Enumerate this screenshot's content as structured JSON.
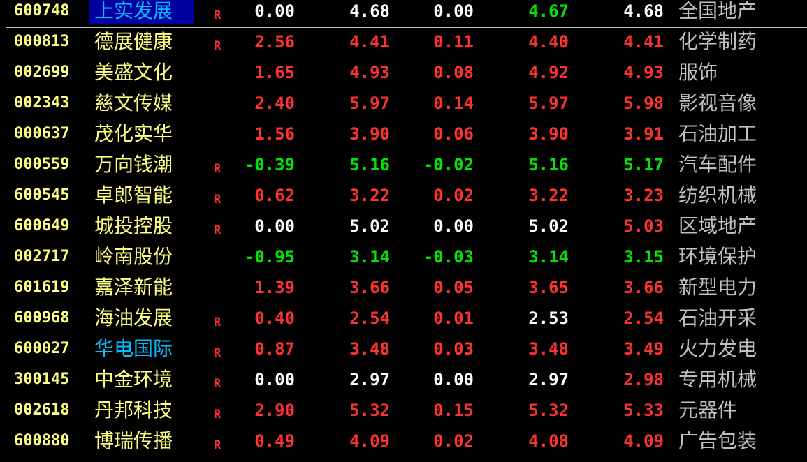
{
  "colors": {
    "background": "#000000",
    "up": "#ff3232",
    "down": "#00e600",
    "flat": "#ffffff",
    "code": "#ffff80",
    "highlight_name": "#00c0ff",
    "selection_bg": "#0000a0",
    "industry": "#c0c0c0",
    "flag": "#ff3030"
  },
  "rows": [
    {
      "code": "600748",
      "name": "上实发展",
      "flag": "R",
      "change": "0.00",
      "price": "4.68",
      "change_amount": "0.00",
      "bid": "4.67",
      "ask": "4.68",
      "industry": "全国地产",
      "state": "flat",
      "bid_state": "down",
      "ask_state": "flat",
      "name_style": "selected"
    },
    {
      "code": "000813",
      "name": "德展健康",
      "flag": "R",
      "change": "2.56",
      "price": "4.41",
      "change_amount": "0.11",
      "bid": "4.40",
      "ask": "4.41",
      "industry": "化学制药",
      "state": "up",
      "bid_state": "up",
      "ask_state": "up",
      "name_style": "normal"
    },
    {
      "code": "002699",
      "name": "美盛文化",
      "flag": "",
      "change": "1.65",
      "price": "4.93",
      "change_amount": "0.08",
      "bid": "4.92",
      "ask": "4.93",
      "industry": "服饰",
      "state": "up",
      "bid_state": "up",
      "ask_state": "up",
      "name_style": "normal"
    },
    {
      "code": "002343",
      "name": "慈文传媒",
      "flag": "",
      "change": "2.40",
      "price": "5.97",
      "change_amount": "0.14",
      "bid": "5.97",
      "ask": "5.98",
      "industry": "影视音像",
      "state": "up",
      "bid_state": "up",
      "ask_state": "up",
      "name_style": "normal"
    },
    {
      "code": "000637",
      "name": "茂化实华",
      "flag": "",
      "change": "1.56",
      "price": "3.90",
      "change_amount": "0.06",
      "bid": "3.90",
      "ask": "3.91",
      "industry": "石油加工",
      "state": "up",
      "bid_state": "up",
      "ask_state": "up",
      "name_style": "normal"
    },
    {
      "code": "000559",
      "name": "万向钱潮",
      "flag": "R",
      "change": "-0.39",
      "price": "5.16",
      "change_amount": "-0.02",
      "bid": "5.16",
      "ask": "5.17",
      "industry": "汽车配件",
      "state": "down",
      "bid_state": "down",
      "ask_state": "down",
      "name_style": "normal"
    },
    {
      "code": "600545",
      "name": "卓郎智能",
      "flag": "R",
      "change": "0.62",
      "price": "3.22",
      "change_amount": "0.02",
      "bid": "3.22",
      "ask": "3.23",
      "industry": "纺织机械",
      "state": "up",
      "bid_state": "up",
      "ask_state": "up",
      "name_style": "normal"
    },
    {
      "code": "600649",
      "name": "城投控股",
      "flag": "R",
      "change": "0.00",
      "price": "5.02",
      "change_amount": "0.00",
      "bid": "5.02",
      "ask": "5.03",
      "industry": "区域地产",
      "state": "flat",
      "bid_state": "flat",
      "ask_state": "up",
      "name_style": "normal"
    },
    {
      "code": "002717",
      "name": "岭南股份",
      "flag": "",
      "change": "-0.95",
      "price": "3.14",
      "change_amount": "-0.03",
      "bid": "3.14",
      "ask": "3.15",
      "industry": "环境保护",
      "state": "down",
      "bid_state": "down",
      "ask_state": "down",
      "name_style": "normal"
    },
    {
      "code": "601619",
      "name": "嘉泽新能",
      "flag": "",
      "change": "1.39",
      "price": "3.66",
      "change_amount": "0.05",
      "bid": "3.65",
      "ask": "3.66",
      "industry": "新型电力",
      "state": "up",
      "bid_state": "up",
      "ask_state": "up",
      "name_style": "normal"
    },
    {
      "code": "600968",
      "name": "海油发展",
      "flag": "R",
      "change": "0.40",
      "price": "2.54",
      "change_amount": "0.01",
      "bid": "2.53",
      "ask": "2.54",
      "industry": "石油开采",
      "state": "up",
      "bid_state": "flat",
      "ask_state": "up",
      "name_style": "normal"
    },
    {
      "code": "600027",
      "name": "华电国际",
      "flag": "R",
      "change": "0.87",
      "price": "3.48",
      "change_amount": "0.03",
      "bid": "3.48",
      "ask": "3.49",
      "industry": "火力发电",
      "state": "up",
      "bid_state": "up",
      "ask_state": "up",
      "name_style": "blue"
    },
    {
      "code": "300145",
      "name": "中金环境",
      "flag": "R",
      "change": "0.00",
      "price": "2.97",
      "change_amount": "0.00",
      "bid": "2.97",
      "ask": "2.98",
      "industry": "专用机械",
      "state": "flat",
      "bid_state": "flat",
      "ask_state": "up",
      "name_style": "normal"
    },
    {
      "code": "002618",
      "name": "丹邦科技",
      "flag": "R",
      "change": "2.90",
      "price": "5.32",
      "change_amount": "0.15",
      "bid": "5.32",
      "ask": "5.33",
      "industry": "元器件",
      "state": "up",
      "bid_state": "up",
      "ask_state": "up",
      "name_style": "normal"
    },
    {
      "code": "600880",
      "name": "博瑞传播",
      "flag": "R",
      "change": "0.49",
      "price": "4.09",
      "change_amount": "0.02",
      "bid": "4.08",
      "ask": "4.09",
      "industry": "广告包装",
      "state": "up",
      "bid_state": "up",
      "ask_state": "up",
      "name_style": "normal"
    }
  ]
}
